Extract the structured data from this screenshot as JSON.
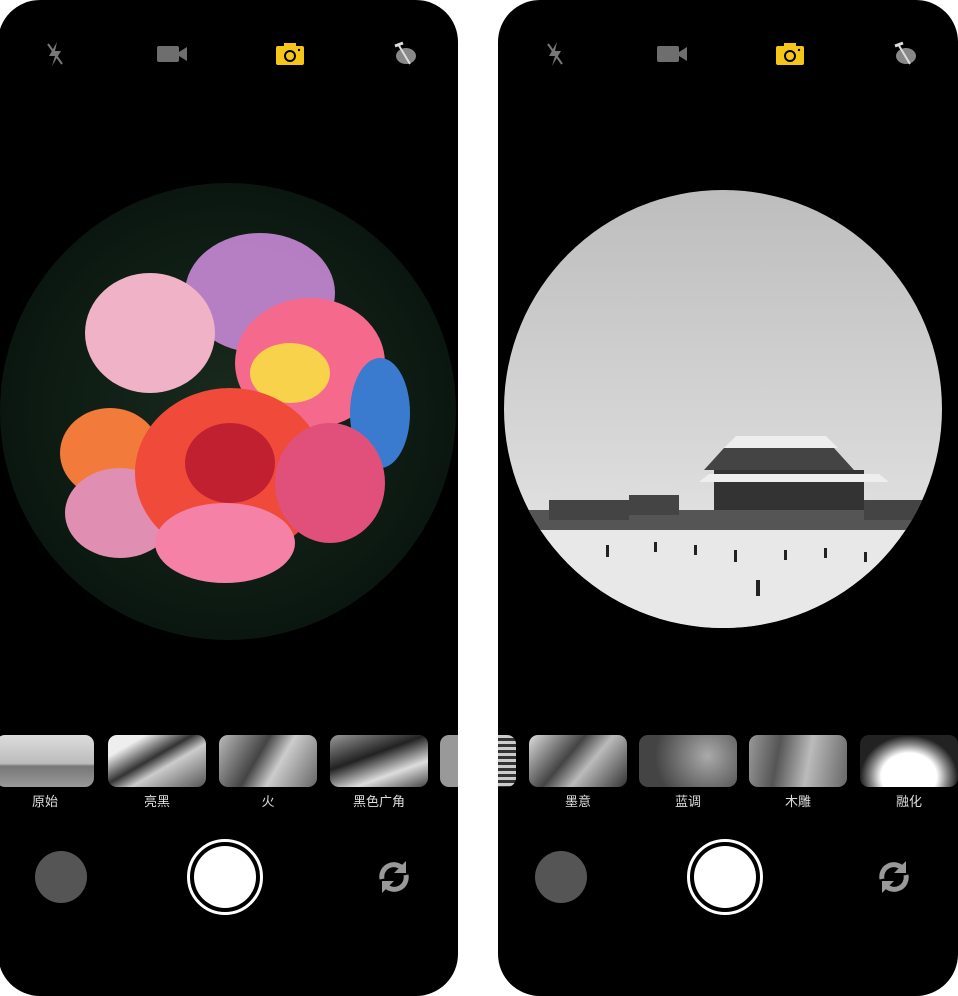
{
  "colors": {
    "accent": "#f5c518",
    "icon_gray": "#6e6e6e",
    "background": "#000000"
  },
  "toolbar_icons": [
    "flash-off-icon",
    "video-camera-icon",
    "photo-camera-icon",
    "palette-icon"
  ],
  "screens": [
    {
      "viewfinder": "flower",
      "filters": [
        {
          "label": "原始"
        },
        {
          "label": "亮黑"
        },
        {
          "label": "火"
        },
        {
          "label": "黑色广角"
        },
        {
          "label": ""
        }
      ]
    },
    {
      "viewfinder": "palace",
      "filters": [
        {
          "label": ""
        },
        {
          "label": "墨意"
        },
        {
          "label": "蓝调"
        },
        {
          "label": "木雕"
        },
        {
          "label": "融化"
        }
      ]
    }
  ]
}
